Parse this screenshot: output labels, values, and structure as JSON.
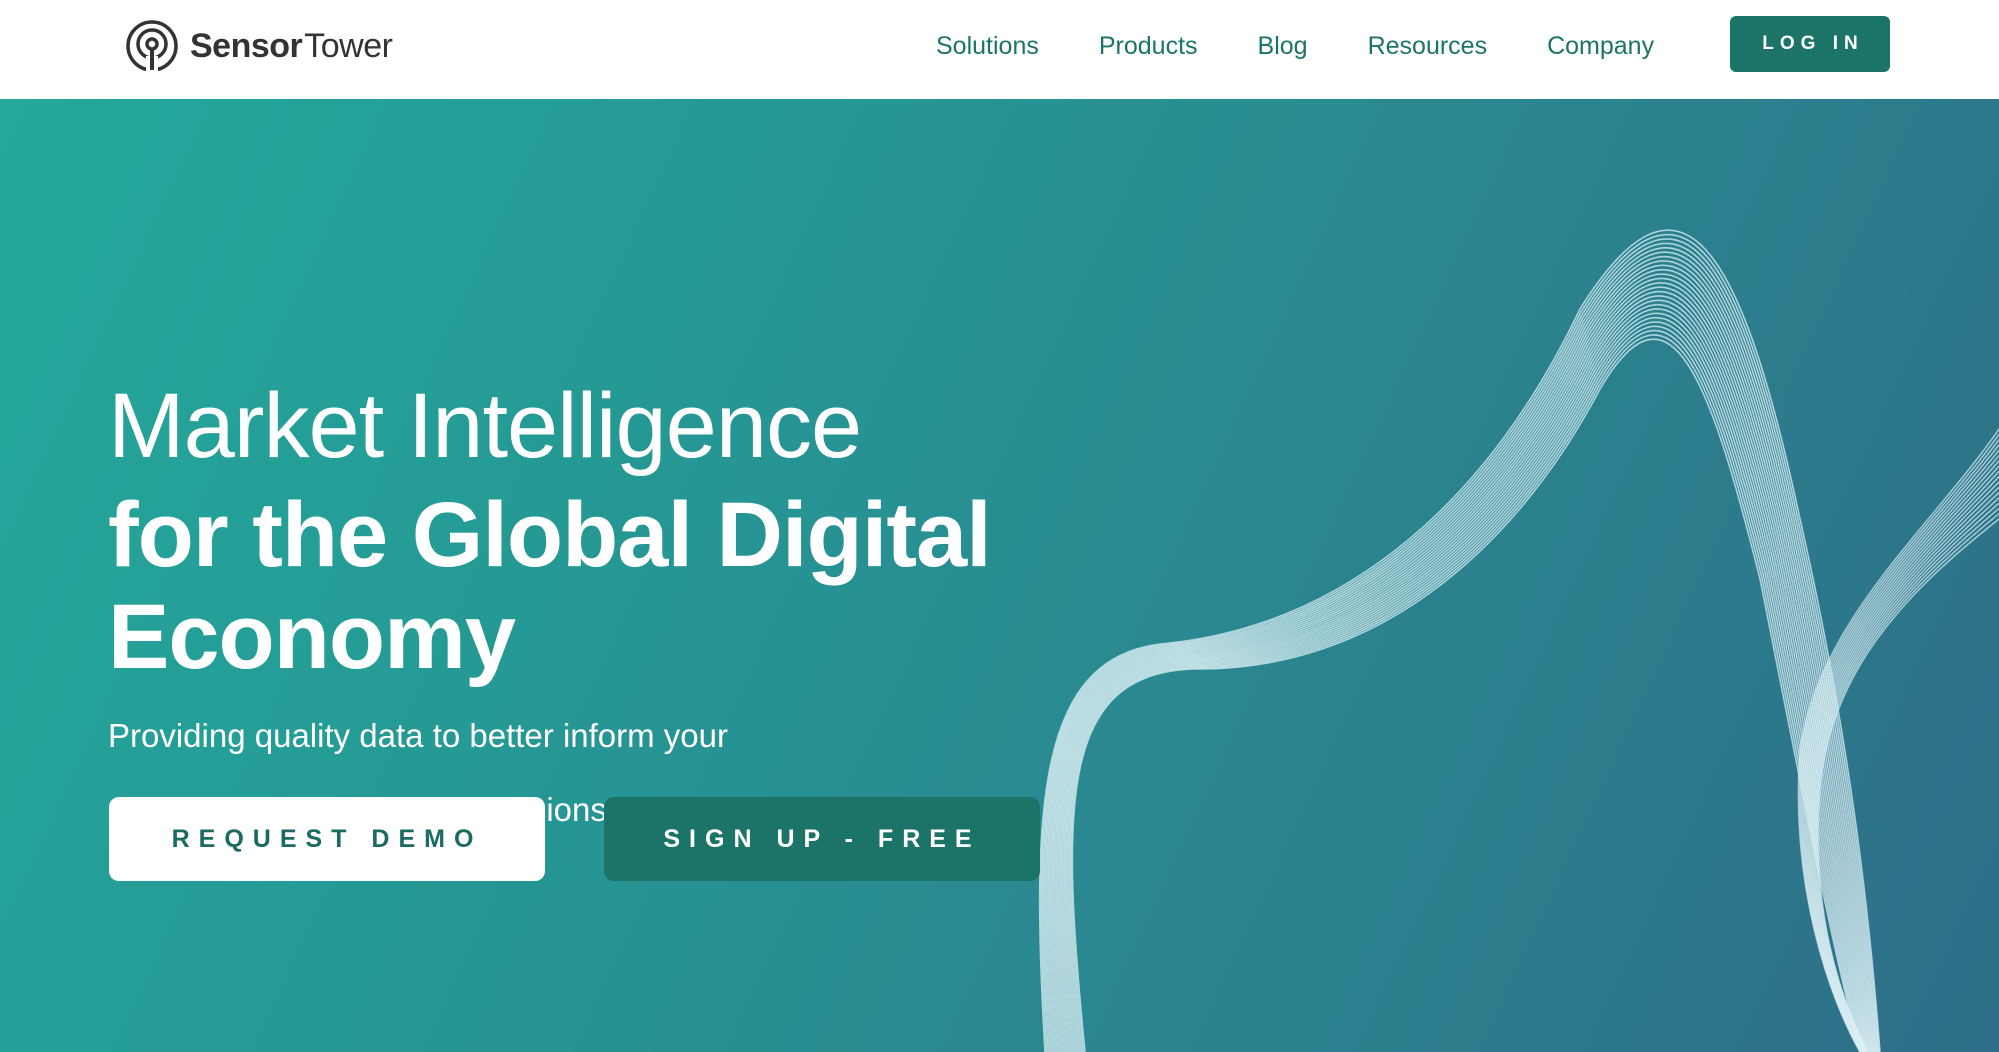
{
  "brand": {
    "name_part1": "Sensor",
    "name_part2": "Tower",
    "logo_icon": "sensor-tower-logo-icon"
  },
  "nav": {
    "items": [
      {
        "label": "Solutions"
      },
      {
        "label": "Products"
      },
      {
        "label": "Blog"
      },
      {
        "label": "Resources"
      },
      {
        "label": "Company"
      }
    ],
    "login_label": "LOG IN"
  },
  "hero": {
    "headline_light": "Market Intelligence",
    "headline_bold": "for the Global Digital Economy",
    "subtext_line1": "Providing quality data to better inform your",
    "subtext_line2": "most important strategic decisions.",
    "primary_cta": "REQUEST DEMO",
    "secondary_cta": "SIGN UP - FREE"
  },
  "colors": {
    "brand_green": "#1b7467",
    "hero_gradient_start": "#23a89b",
    "hero_gradient_end": "#2e6e88",
    "text_dark": "#333333",
    "white": "#ffffff"
  }
}
